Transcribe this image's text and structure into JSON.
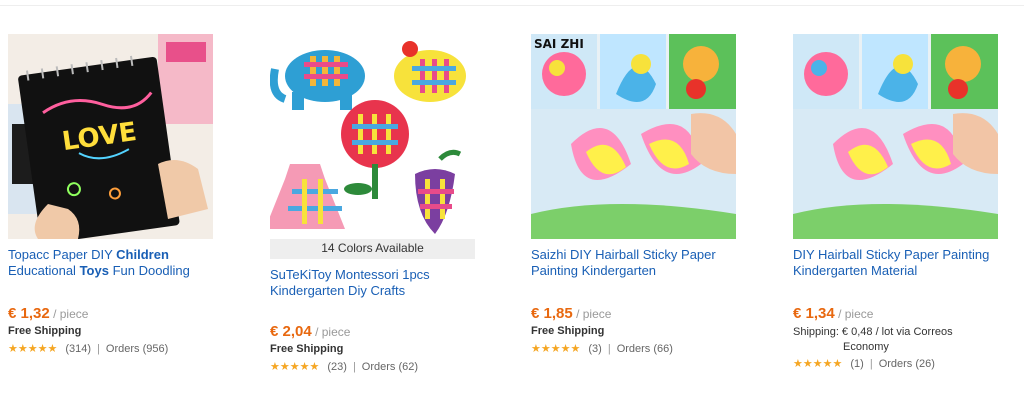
{
  "products": [
    {
      "title_parts": [
        "Topacc Paper DIY ",
        "Children",
        " Educational ",
        "Toys",
        " Fun Doodling"
      ],
      "price": "€ 1,32",
      "unit": "/ piece",
      "shipping": "Free Shipping",
      "reviews": "(314)",
      "orders_label": "Orders",
      "orders": "(956)",
      "rating": 5,
      "image_icon": "scratch-paper-notebook-image"
    },
    {
      "title": "SuTeKiToy Montessori 1pcs Kindergarten Diy Crafts",
      "colors_available": "14 Colors Available",
      "price": "€ 2,04",
      "unit": "/ piece",
      "shipping": "Free Shipping",
      "reviews": "(23)",
      "orders_label": "Orders",
      "orders": "(62)",
      "rating": 5,
      "image_icon": "felt-weaving-crafts-image"
    },
    {
      "title": "Saizhi DIY Hairball Sticky Paper Painting Kindergarten",
      "price": "€ 1,85",
      "unit": "/ piece",
      "shipping": "Free Shipping",
      "reviews": "(3)",
      "orders_label": "Orders",
      "orders": "(66)",
      "rating": 5,
      "image_icon": "hairball-butterfly-image",
      "image_brand": "SAI ZHI"
    },
    {
      "title": "DIY Hairball Sticky Paper Painting Kindergarten Material",
      "price": "€ 1,34",
      "unit": "/ piece",
      "shipping_line1": "Shipping: € 0,48 / lot via Correos",
      "shipping_line2": "Economy",
      "reviews": "(1)",
      "orders_label": "Orders",
      "orders": "(26)",
      "rating": 5,
      "image_icon": "hairball-butterfly-image"
    }
  ],
  "colors": {
    "price": "#e8680f",
    "link": "#195fb5",
    "star": "#f5a623"
  }
}
